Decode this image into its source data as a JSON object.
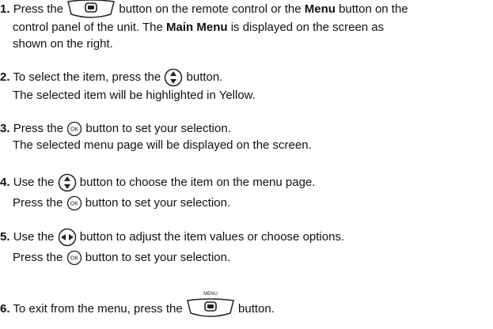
{
  "steps": [
    {
      "num": "1.",
      "pre": "Press the",
      "post": "button on the remote control or the",
      "menu_word": "Menu",
      "post2": "button on the",
      "line2a": "control panel of the unit. The",
      "main_menu": "Main Menu",
      "line2b": "is displayed on the screen as",
      "line3": "shown on the right.",
      "icon": "menu-button-icon"
    },
    {
      "num": "2.",
      "pre": "To select the item, press the",
      "post": "button.",
      "line2": "The selected item will be highlighted in Yellow.",
      "icon": "up-down-button-icon"
    },
    {
      "num": "3.",
      "pre": "Press the",
      "post": "button to set your selection.",
      "line2": "The selected menu page will be displayed on the screen.",
      "icon": "ok-button-icon"
    },
    {
      "num": "4.",
      "pre": "Use the",
      "post": "button to choose the item on the menu page.",
      "line2_pre": "Press the",
      "line2_post": "button to set your selection.",
      "icon": "up-down-button-icon"
    },
    {
      "num": "5.",
      "pre": "Use the",
      "post": "button to adjust the item values or choose options.",
      "line2_pre": "Press the",
      "line2_post": "button to set your selection.",
      "icon": "left-right-button-icon"
    },
    {
      "num": "6.",
      "pre": "To exit from the menu, press the",
      "post": "button.",
      "icon_label": "MENU",
      "icon": "menu-button-icon"
    }
  ],
  "ok_label": "OK",
  "colors": {
    "text": "#111111",
    "icon_stroke": "#222222"
  }
}
